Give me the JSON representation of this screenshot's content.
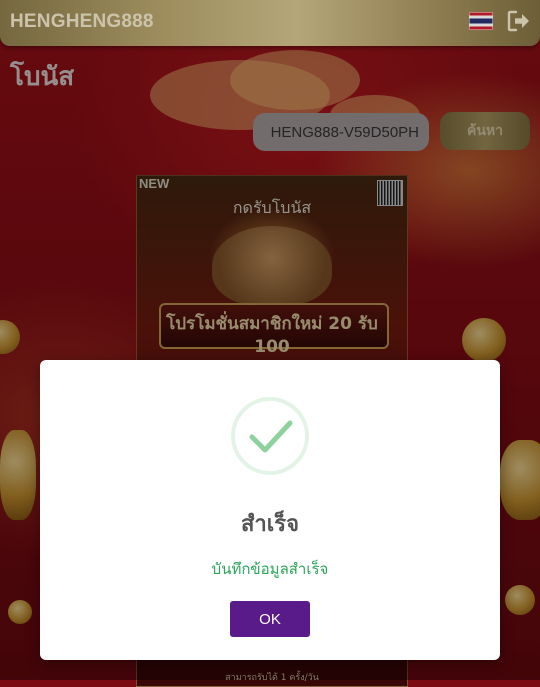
{
  "header": {
    "brand": "HENGHENG888",
    "flag_icon": "thailand-flag-icon",
    "logout_icon": "logout-icon"
  },
  "page": {
    "title": "โบนัส"
  },
  "search": {
    "code_value": "HENG888-V59D50PH",
    "button_label": "ค้นหา"
  },
  "poster": {
    "badge": "NEW",
    "claim_label": "กดรับโบนัส",
    "promo_text": "โปรโมชั่นสมาชิกใหม่ 20 รับ 100",
    "footer_text": "สามารถรับได้ 1 ครั้ง/วัน"
  },
  "modal": {
    "icon": "success-check-icon",
    "title": "สำเร็จ",
    "message": "บันทึกข้อมูลสำเร็จ",
    "ok_label": "OK"
  },
  "colors": {
    "header_gold": "#b9a66e",
    "background_red": "#a8121a",
    "success_green": "#2aa65a",
    "button_purple": "#5a1b8a",
    "check_green": "#8fd19e"
  }
}
